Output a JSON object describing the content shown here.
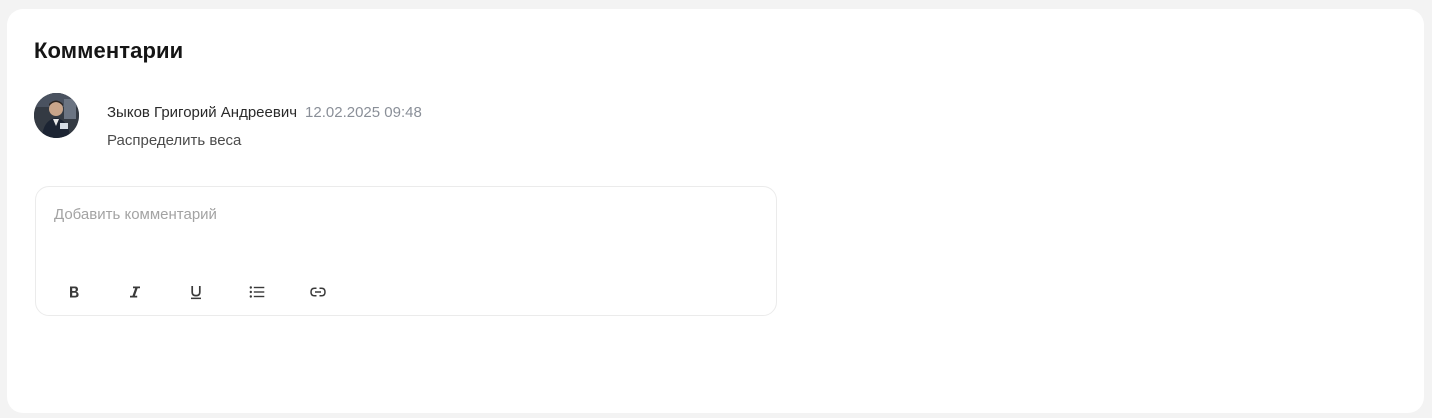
{
  "section": {
    "title": "Комментарии"
  },
  "comments": [
    {
      "author": "Зыков Григорий Андреевич",
      "timestamp": "12.02.2025 09:48",
      "text": "Распределить веса",
      "avatar": "user-photo"
    }
  ],
  "editor": {
    "placeholder": "Добавить комментарий",
    "value": "",
    "toolbar": [
      {
        "name": "bold-icon",
        "label": "B"
      },
      {
        "name": "italic-icon",
        "label": "I"
      },
      {
        "name": "underline-icon",
        "label": "U"
      },
      {
        "name": "bulleted-list-icon",
        "label": "list"
      },
      {
        "name": "link-icon",
        "label": "link"
      }
    ]
  },
  "colors": {
    "background": "#f3f3f3",
    "panel": "#ffffff",
    "timestamp": "#8a8f98",
    "placeholder": "#a3a3a3",
    "editor_border": "#ebebeb"
  }
}
